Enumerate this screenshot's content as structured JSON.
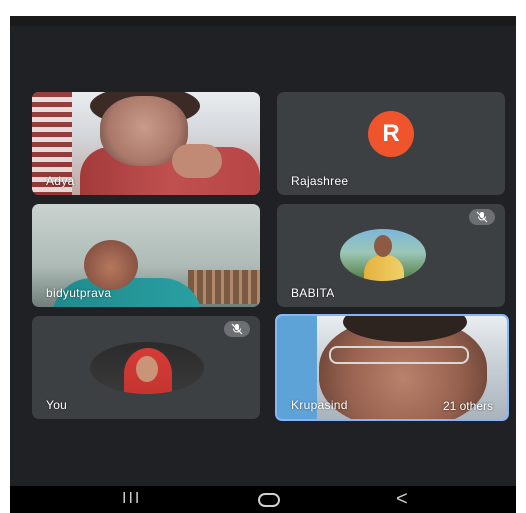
{
  "participants": [
    {
      "name": "Adya",
      "type": "video",
      "muted": false
    },
    {
      "name": "Rajashree",
      "type": "avatar",
      "avatar_letter": "R",
      "avatar_color": "#f0542c",
      "muted": false
    },
    {
      "name": "bidyutprava",
      "type": "video",
      "muted": false
    },
    {
      "name": "BABITA",
      "type": "photo",
      "muted": true
    },
    {
      "name": "You",
      "type": "photo",
      "muted": true
    },
    {
      "name": "Krupasind",
      "type": "video",
      "muted": false,
      "active_speaker": true
    }
  ],
  "overflow": {
    "label": "21 others"
  },
  "colors": {
    "background": "#202124",
    "tile": "#3c4043",
    "active_border": "#8ab4f8"
  },
  "navbar": {
    "recents_label": "III",
    "back_label": "<"
  }
}
